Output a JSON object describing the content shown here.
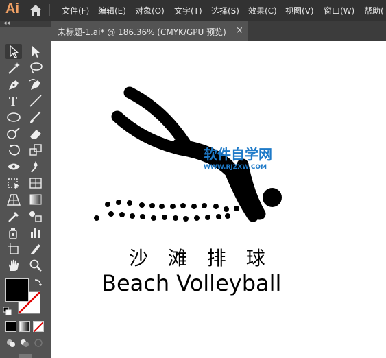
{
  "app": {
    "logo": "Ai"
  },
  "menu": [
    {
      "label": "文件(F)"
    },
    {
      "label": "编辑(E)"
    },
    {
      "label": "对象(O)"
    },
    {
      "label": "文字(T)"
    },
    {
      "label": "选择(S)"
    },
    {
      "label": "效果(C)"
    },
    {
      "label": "视图(V)"
    },
    {
      "label": "窗口(W)"
    },
    {
      "label": "帮助("
    }
  ],
  "panel": {
    "collapse": "◂◂"
  },
  "document_tab": {
    "title": "未标题-1.ai* @ 186.36% (CMYK/GPU 预览)",
    "close": "×"
  },
  "artwork": {
    "title_cn": "沙 滩 排 球",
    "title_en": "Beach Volleyball",
    "watermark_cn": "软件自学网",
    "watermark_url": "WWW.RJZXW.COM"
  },
  "colors": {
    "fill": "#000000",
    "stroke": "none",
    "watermark": "#1e7ac8"
  }
}
